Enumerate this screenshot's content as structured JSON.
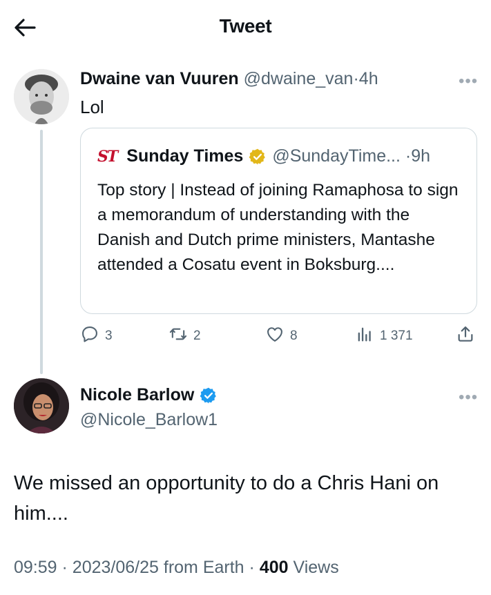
{
  "header": {
    "title": "Tweet"
  },
  "parent_tweet": {
    "name": "Dwaine van Vuuren",
    "handle": "@dwaine_van",
    "separator": "·",
    "time": "4h",
    "text": "Lol",
    "more_icon": "more-horizontal-icon"
  },
  "quoted_tweet": {
    "logo_text": "ST",
    "name": "Sunday Times",
    "verified": "gold-verified-badge-icon",
    "handle": "@SundayTime...",
    "separator": "·",
    "time": "9h",
    "text": "Top story | Instead of joining Ramaphosa to sign a memorandum of understanding with the Danish and Dutch prime ministers, Mantashe attended a Cosatu event in Boksburg...."
  },
  "actions": {
    "replies": "3",
    "retweets": "2",
    "likes": "8",
    "views": "1 371"
  },
  "reply_tweet": {
    "name": "Nicole Barlow",
    "verified": "blue-verified-badge-icon",
    "handle": "@Nicole_Barlow1",
    "text": "We missed an opportunity to do a Chris Hani on him....",
    "more_icon": "more-horizontal-icon"
  },
  "meta": {
    "time": "09:59",
    "sep1": "·",
    "date": "2023/06/25",
    "from": "from Earth",
    "sep2": "·",
    "views_count": "400",
    "views_label": "Views"
  },
  "colors": {
    "text": "#0f1419",
    "secondary": "#536471",
    "border": "#cfd9de",
    "blue_check": "#1d9bf0",
    "gold_check": "#e2b719",
    "st_red": "#c4102e"
  }
}
